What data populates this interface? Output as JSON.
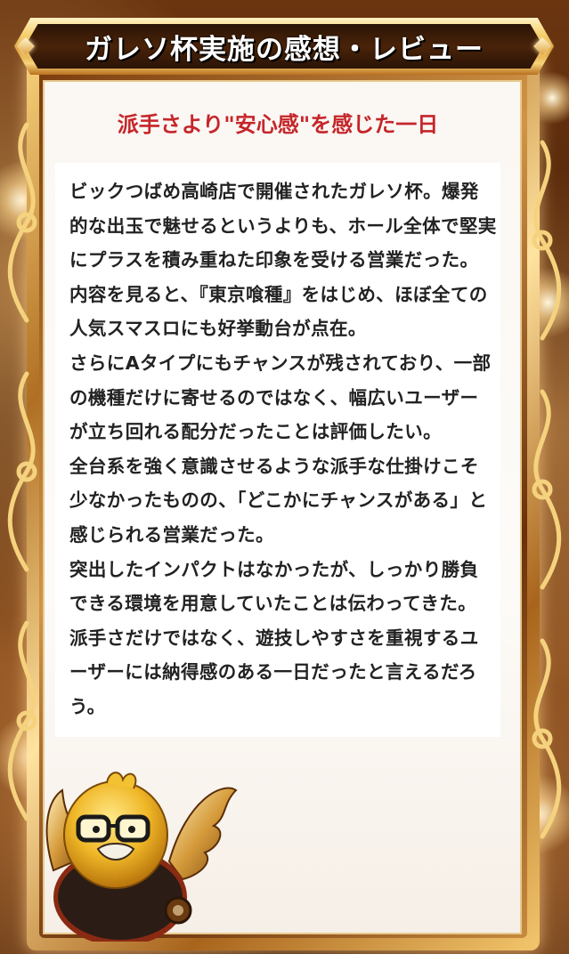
{
  "header": {
    "title": "ガレソ杯実施の感想・レビュー"
  },
  "review": {
    "subtitle": "派手さより\"安心感\"を感じた一日",
    "paragraphs": [
      "ビックつばめ高崎店で開催されたガレソ杯。爆発的な出玉で魅せるというよりも、ホール全体で堅実にプラスを積み重ねた印象を受ける営業だった。",
      "内容を見ると、『東京喰種』をはじめ、ほぼ全ての人気スマスロにも好挙動台が点在。",
      "さらにAタイプにもチャンスが残されており、一部の機種だけに寄せるのではなく、幅広いユーザーが立ち回れる配分だったことは評価したい。",
      "全台系を強く意識させるような派手な仕掛けこそ少なかったものの、「どこかにチャンスがある」と感じられる営業だった。",
      "突出したインパクトはなかったが、しっかり勝負できる環境を用意していたことは伝わってきた。",
      "派手さだけではなく、遊技しやすさを重視するユーザーには納得感のある一日だったと言えるだろう。"
    ]
  },
  "colors": {
    "subtitle": "#c5262a",
    "body_text": "#222222",
    "gold": "#e0a440",
    "banner_dark": "#2a1406"
  },
  "icons": {
    "mascot": "golden-bird-mascot-icon",
    "ornament": "gold-scroll-ornament-icon"
  }
}
